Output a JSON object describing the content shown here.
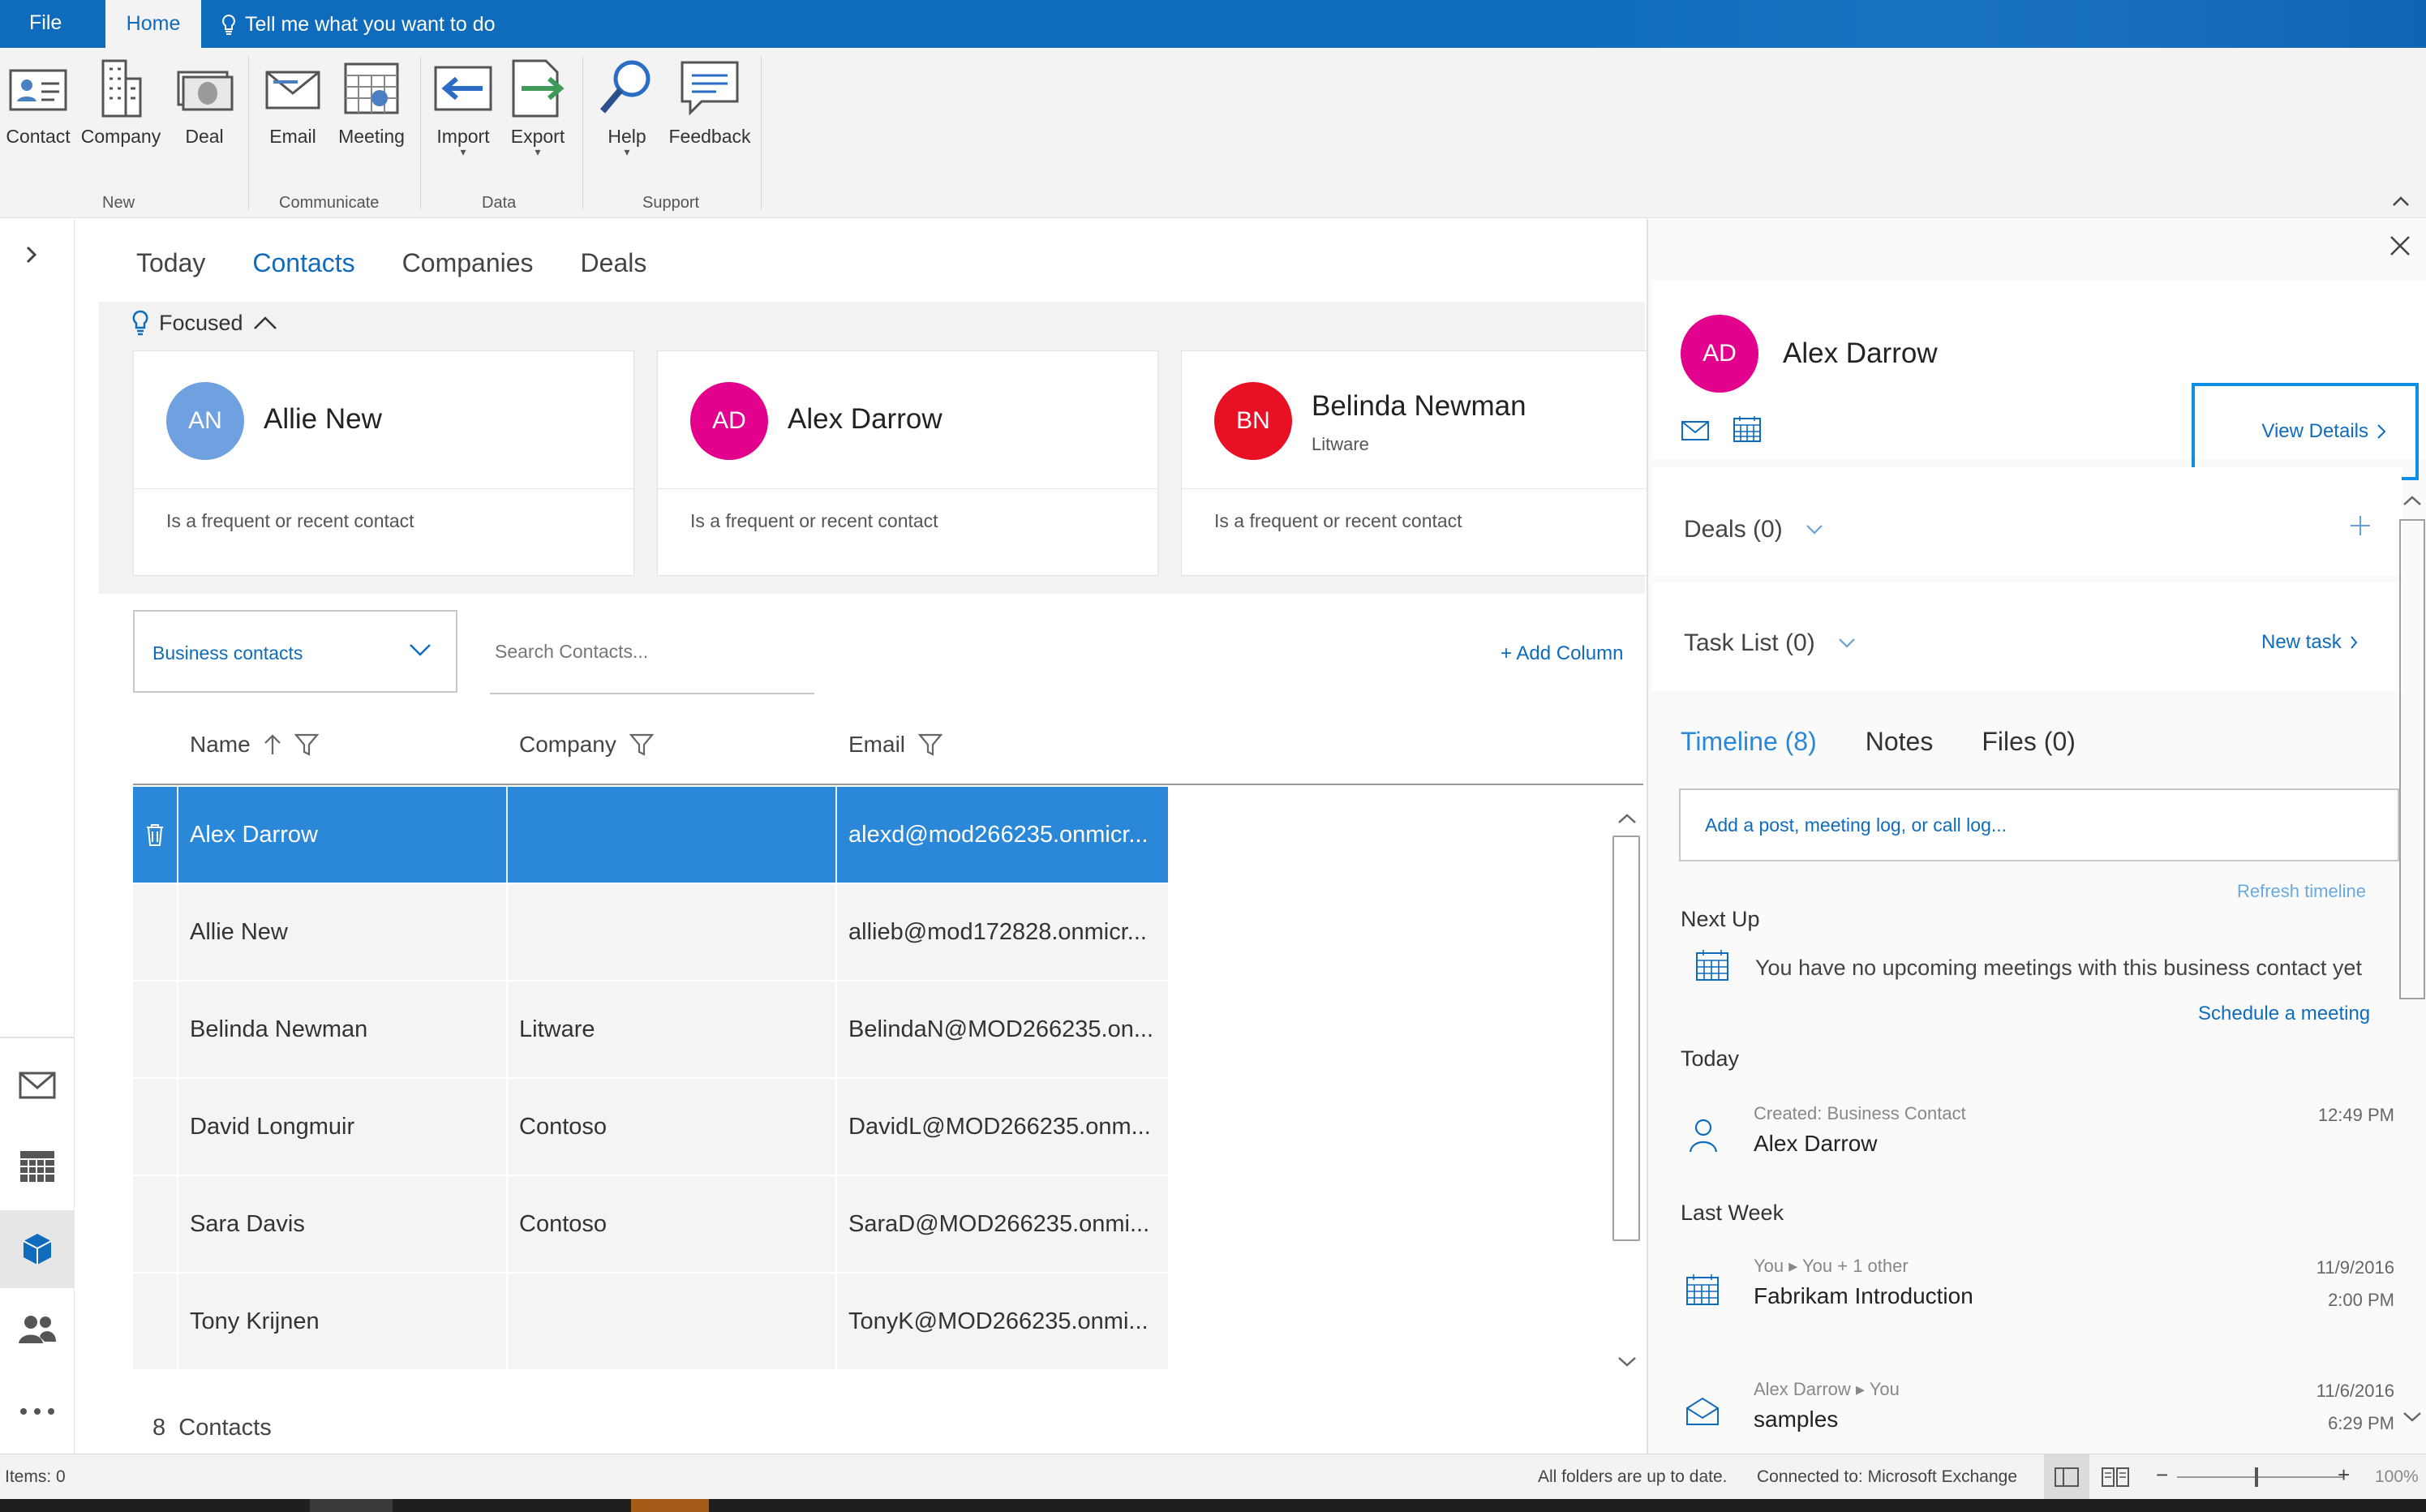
{
  "menu": {
    "file": "File",
    "home": "Home",
    "tell": "Tell me what you want to do"
  },
  "ribbon": {
    "groups": [
      {
        "label": "New",
        "buttons": [
          "Contact",
          "Company",
          "Deal"
        ]
      },
      {
        "label": "Communicate",
        "buttons": [
          "Email",
          "Meeting"
        ]
      },
      {
        "label": "Data",
        "buttons": [
          "Import",
          "Export"
        ]
      },
      {
        "label": "Support",
        "buttons": [
          "Help",
          "Feedback"
        ]
      }
    ]
  },
  "tabs": [
    "Today",
    "Contacts",
    "Companies",
    "Deals"
  ],
  "focused": {
    "label": "Focused",
    "cards": [
      {
        "initials": "AN",
        "name": "Allie New",
        "company": "",
        "reason": "Is a frequent or recent contact",
        "color": "#6fa1e0"
      },
      {
        "initials": "AD",
        "name": "Alex Darrow",
        "company": "",
        "reason": "Is a frequent or recent contact",
        "color": "#e3008c"
      },
      {
        "initials": "BN",
        "name": "Belinda Newman",
        "company": "Litware",
        "reason": "Is a frequent or recent contact",
        "color": "#e81123"
      }
    ]
  },
  "list": {
    "view": "Business contacts",
    "search_placeholder": "Search Contacts...",
    "add_column": "+ Add Column",
    "columns": [
      "Name",
      "Company",
      "Email"
    ],
    "rows": [
      {
        "name": "Alex Darrow",
        "company": "",
        "email": "alexd@mod266235.onmicr..."
      },
      {
        "name": "Allie New",
        "company": "",
        "email": "allieb@mod172828.onmicr..."
      },
      {
        "name": "Belinda Newman",
        "company": "Litware",
        "email": "BelindaN@MOD266235.on..."
      },
      {
        "name": "David Longmuir",
        "company": "Contoso",
        "email": "DavidL@MOD266235.onm..."
      },
      {
        "name": "Sara Davis",
        "company": "Contoso",
        "email": "SaraD@MOD266235.onmi..."
      },
      {
        "name": "Tony Krijnen",
        "company": "",
        "email": "TonyK@MOD266235.onmi..."
      }
    ],
    "count_number": "8",
    "count_label": "Contacts"
  },
  "detail": {
    "initials": "AD",
    "name": "Alex Darrow",
    "avatar_color": "#e3008c",
    "view_details": "View Details",
    "deals": "Deals (0)",
    "tasks": "Task List (0)",
    "new_task": "New task",
    "tabs": [
      "Timeline (8)",
      "Notes",
      "Files (0)"
    ],
    "post_placeholder": "Add a post, meeting log, or call log...",
    "refresh": "Refresh timeline",
    "next_up": "Next Up",
    "no_meetings": "You have no upcoming meetings with this business contact yet",
    "schedule": "Schedule a meeting",
    "today": "Today",
    "item1_meta": "Created: Business Contact",
    "item1_title": "Alex Darrow",
    "item1_time": "12:49 PM",
    "last_week": "Last Week",
    "item2_from": "You",
    "item2_to": "You + 1 other",
    "item2_title": "Fabrikam Introduction",
    "item2_date": "11/9/2016",
    "item2_time": "2:00 PM",
    "item3_from": "Alex Darrow",
    "item3_to": "You",
    "item3_title": "samples",
    "item3_date": "11/6/2016",
    "item3_time": "6:29 PM"
  },
  "status": {
    "items": "Items: 0",
    "sync": "All folders are up to date.",
    "connection": "Connected to: Microsoft Exchange",
    "zoom": "100%"
  },
  "colors": {
    "accent": "#0f6cbd",
    "selected_row": "#2b88d8",
    "focus_border": "#0f8ee6"
  }
}
